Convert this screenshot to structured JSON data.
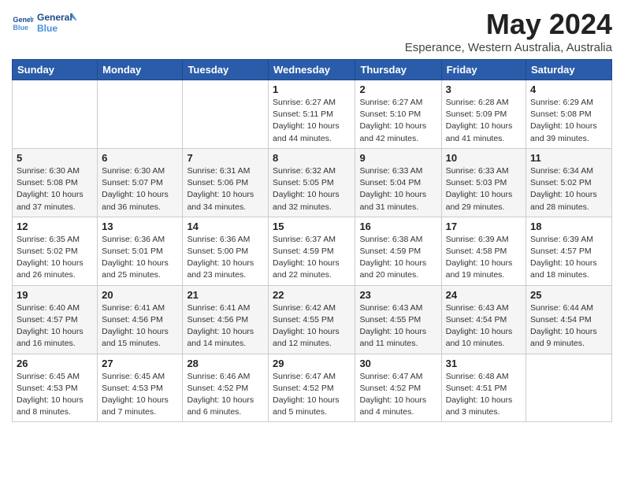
{
  "header": {
    "logo_line1": "General",
    "logo_line2": "Blue",
    "title": "May 2024",
    "subtitle": "Esperance, Western Australia, Australia"
  },
  "weekdays": [
    "Sunday",
    "Monday",
    "Tuesday",
    "Wednesday",
    "Thursday",
    "Friday",
    "Saturday"
  ],
  "weeks": [
    [
      {
        "day": "",
        "info": ""
      },
      {
        "day": "",
        "info": ""
      },
      {
        "day": "",
        "info": ""
      },
      {
        "day": "1",
        "info": "Sunrise: 6:27 AM\nSunset: 5:11 PM\nDaylight: 10 hours\nand 44 minutes."
      },
      {
        "day": "2",
        "info": "Sunrise: 6:27 AM\nSunset: 5:10 PM\nDaylight: 10 hours\nand 42 minutes."
      },
      {
        "day": "3",
        "info": "Sunrise: 6:28 AM\nSunset: 5:09 PM\nDaylight: 10 hours\nand 41 minutes."
      },
      {
        "day": "4",
        "info": "Sunrise: 6:29 AM\nSunset: 5:08 PM\nDaylight: 10 hours\nand 39 minutes."
      }
    ],
    [
      {
        "day": "5",
        "info": "Sunrise: 6:30 AM\nSunset: 5:08 PM\nDaylight: 10 hours\nand 37 minutes."
      },
      {
        "day": "6",
        "info": "Sunrise: 6:30 AM\nSunset: 5:07 PM\nDaylight: 10 hours\nand 36 minutes."
      },
      {
        "day": "7",
        "info": "Sunrise: 6:31 AM\nSunset: 5:06 PM\nDaylight: 10 hours\nand 34 minutes."
      },
      {
        "day": "8",
        "info": "Sunrise: 6:32 AM\nSunset: 5:05 PM\nDaylight: 10 hours\nand 32 minutes."
      },
      {
        "day": "9",
        "info": "Sunrise: 6:33 AM\nSunset: 5:04 PM\nDaylight: 10 hours\nand 31 minutes."
      },
      {
        "day": "10",
        "info": "Sunrise: 6:33 AM\nSunset: 5:03 PM\nDaylight: 10 hours\nand 29 minutes."
      },
      {
        "day": "11",
        "info": "Sunrise: 6:34 AM\nSunset: 5:02 PM\nDaylight: 10 hours\nand 28 minutes."
      }
    ],
    [
      {
        "day": "12",
        "info": "Sunrise: 6:35 AM\nSunset: 5:02 PM\nDaylight: 10 hours\nand 26 minutes."
      },
      {
        "day": "13",
        "info": "Sunrise: 6:36 AM\nSunset: 5:01 PM\nDaylight: 10 hours\nand 25 minutes."
      },
      {
        "day": "14",
        "info": "Sunrise: 6:36 AM\nSunset: 5:00 PM\nDaylight: 10 hours\nand 23 minutes."
      },
      {
        "day": "15",
        "info": "Sunrise: 6:37 AM\nSunset: 4:59 PM\nDaylight: 10 hours\nand 22 minutes."
      },
      {
        "day": "16",
        "info": "Sunrise: 6:38 AM\nSunset: 4:59 PM\nDaylight: 10 hours\nand 20 minutes."
      },
      {
        "day": "17",
        "info": "Sunrise: 6:39 AM\nSunset: 4:58 PM\nDaylight: 10 hours\nand 19 minutes."
      },
      {
        "day": "18",
        "info": "Sunrise: 6:39 AM\nSunset: 4:57 PM\nDaylight: 10 hours\nand 18 minutes."
      }
    ],
    [
      {
        "day": "19",
        "info": "Sunrise: 6:40 AM\nSunset: 4:57 PM\nDaylight: 10 hours\nand 16 minutes."
      },
      {
        "day": "20",
        "info": "Sunrise: 6:41 AM\nSunset: 4:56 PM\nDaylight: 10 hours\nand 15 minutes."
      },
      {
        "day": "21",
        "info": "Sunrise: 6:41 AM\nSunset: 4:56 PM\nDaylight: 10 hours\nand 14 minutes."
      },
      {
        "day": "22",
        "info": "Sunrise: 6:42 AM\nSunset: 4:55 PM\nDaylight: 10 hours\nand 12 minutes."
      },
      {
        "day": "23",
        "info": "Sunrise: 6:43 AM\nSunset: 4:55 PM\nDaylight: 10 hours\nand 11 minutes."
      },
      {
        "day": "24",
        "info": "Sunrise: 6:43 AM\nSunset: 4:54 PM\nDaylight: 10 hours\nand 10 minutes."
      },
      {
        "day": "25",
        "info": "Sunrise: 6:44 AM\nSunset: 4:54 PM\nDaylight: 10 hours\nand 9 minutes."
      }
    ],
    [
      {
        "day": "26",
        "info": "Sunrise: 6:45 AM\nSunset: 4:53 PM\nDaylight: 10 hours\nand 8 minutes."
      },
      {
        "day": "27",
        "info": "Sunrise: 6:45 AM\nSunset: 4:53 PM\nDaylight: 10 hours\nand 7 minutes."
      },
      {
        "day": "28",
        "info": "Sunrise: 6:46 AM\nSunset: 4:52 PM\nDaylight: 10 hours\nand 6 minutes."
      },
      {
        "day": "29",
        "info": "Sunrise: 6:47 AM\nSunset: 4:52 PM\nDaylight: 10 hours\nand 5 minutes."
      },
      {
        "day": "30",
        "info": "Sunrise: 6:47 AM\nSunset: 4:52 PM\nDaylight: 10 hours\nand 4 minutes."
      },
      {
        "day": "31",
        "info": "Sunrise: 6:48 AM\nSunset: 4:51 PM\nDaylight: 10 hours\nand 3 minutes."
      },
      {
        "day": "",
        "info": ""
      }
    ]
  ]
}
